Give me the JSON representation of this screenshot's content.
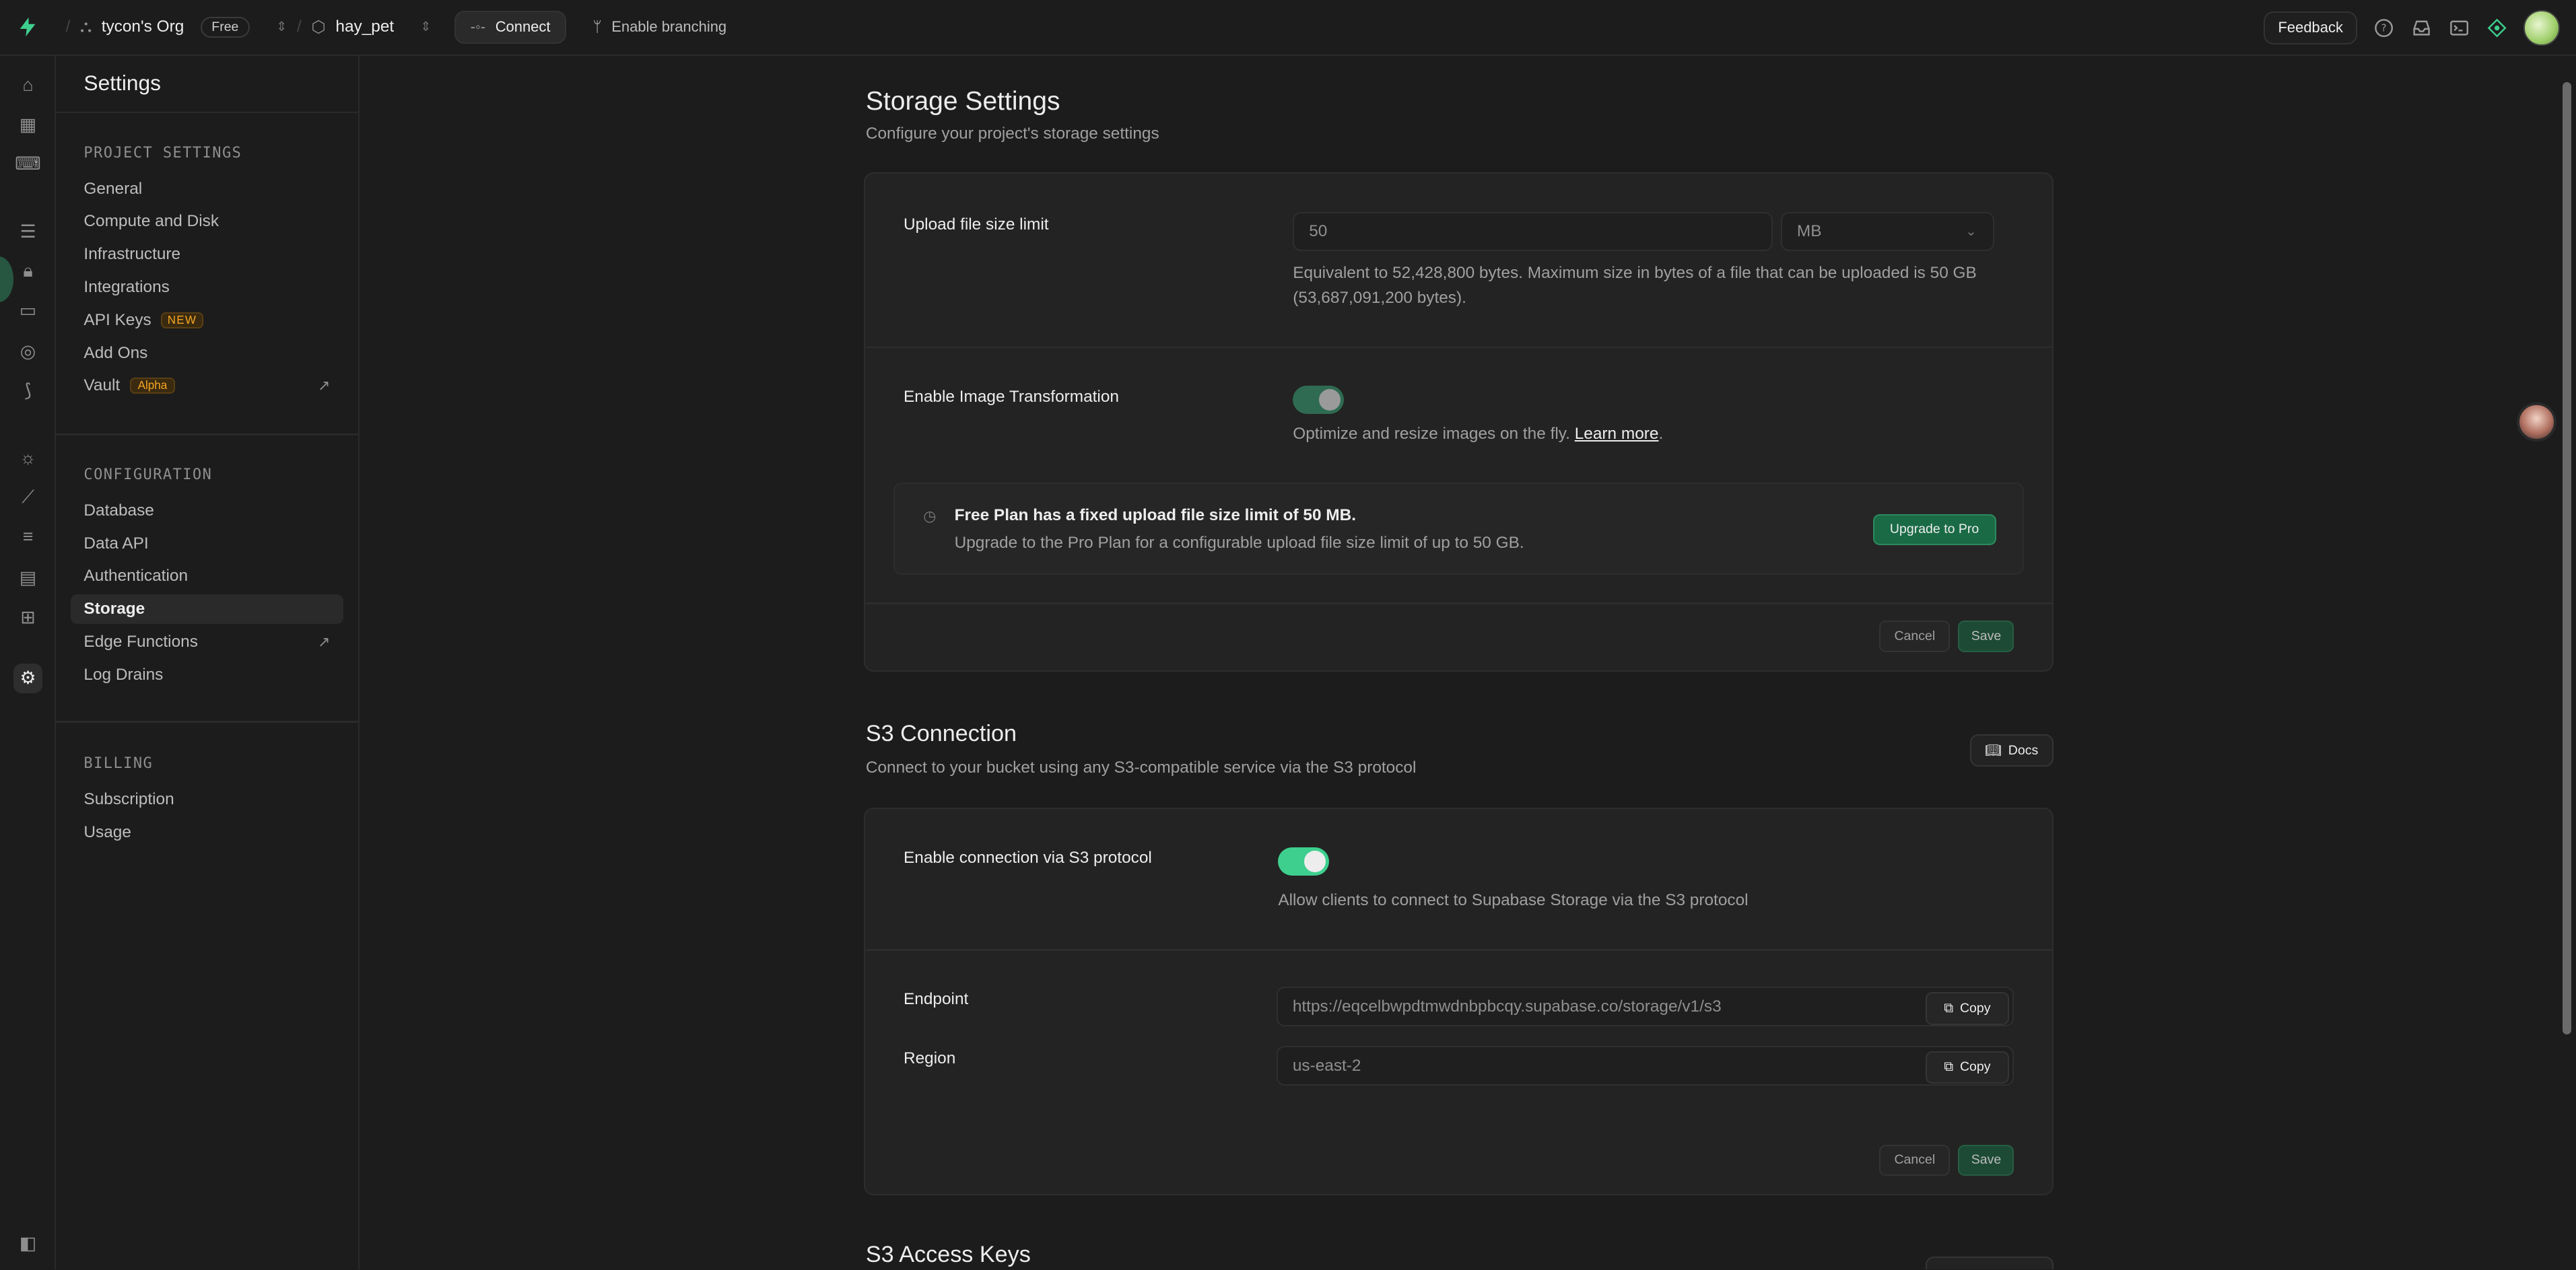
{
  "topbar": {
    "org_name": "tycon's Org",
    "plan_badge": "Free",
    "project_name": "hay_pet",
    "connect_label": "Connect",
    "branching_label": "Enable branching",
    "feedback_label": "Feedback"
  },
  "sidebar": {
    "title": "Settings",
    "project_settings_heading": "PROJECT SETTINGS",
    "project_items": [
      {
        "label": "General"
      },
      {
        "label": "Compute and Disk"
      },
      {
        "label": "Infrastructure"
      },
      {
        "label": "Integrations"
      },
      {
        "label": "API Keys",
        "tag": "NEW"
      },
      {
        "label": "Add Ons"
      },
      {
        "label": "Vault",
        "tag": "Alpha"
      }
    ],
    "configuration_heading": "CONFIGURATION",
    "configuration_items": [
      {
        "label": "Database"
      },
      {
        "label": "Data API"
      },
      {
        "label": "Authentication"
      },
      {
        "label": "Storage"
      },
      {
        "label": "Edge Functions"
      },
      {
        "label": "Log Drains"
      }
    ],
    "billing_heading": "BILLING",
    "billing_items": [
      {
        "label": "Subscription"
      },
      {
        "label": "Usage"
      }
    ]
  },
  "storage": {
    "title": "Storage Settings",
    "subtitle": "Configure your project's storage settings",
    "upload_limit_label": "Upload file size limit",
    "upload_limit_value": "50",
    "upload_limit_unit": "MB",
    "upload_limit_help": "Equivalent to 52,428,800 bytes. Maximum size in bytes of a file that can be uploaded is 50 GB (53,687,091,200 bytes).",
    "image_transform_label": "Enable Image Transformation",
    "image_transform_help": "Optimize and resize images on the fly.",
    "learn_more": "Learn more",
    "notice_title": "Free Plan has a fixed upload file size limit of 50 MB.",
    "notice_text": "Upgrade to the Pro Plan for a configurable upload file size limit of up to 50 GB.",
    "upgrade_label": "Upgrade to Pro",
    "cancel_label": "Cancel",
    "save_label": "Save"
  },
  "s3": {
    "title": "S3 Connection",
    "subtitle": "Connect to your bucket using any S3-compatible service via the S3 protocol",
    "docs_label": "Docs",
    "enable_label": "Enable connection via S3 protocol",
    "enable_help": "Allow clients to connect to Supabase Storage via the S3 protocol",
    "endpoint_label": "Endpoint",
    "endpoint_value": "https://eqcelbwpdtmwdnbpbcqy.supabase.co/storage/v1/s3",
    "region_label": "Region",
    "region_value": "us-east-2",
    "copy_label": "Copy",
    "cancel_label": "Cancel",
    "save_label": "Save"
  },
  "s3_keys": {
    "title": "S3 Access Keys"
  },
  "colors": {
    "brand_green": "#3ecf8e",
    "background": "#1c1c1c",
    "card": "#232323"
  }
}
